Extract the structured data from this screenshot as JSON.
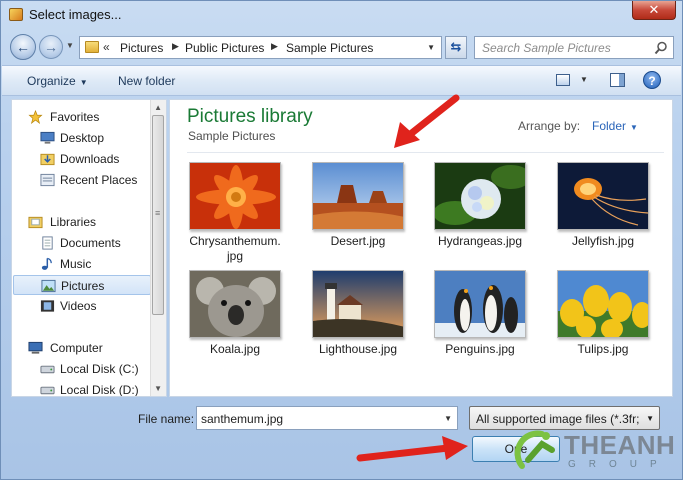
{
  "window": {
    "title": "Select images..."
  },
  "nav": {
    "address": {
      "overflow": "«",
      "crumbs": [
        "Pictures",
        "Public Pictures",
        "Sample Pictures"
      ]
    },
    "search": {
      "placeholder": "Search Sample Pictures"
    }
  },
  "toolbar": {
    "organize": "Organize",
    "new_folder": "New folder"
  },
  "sidebar": {
    "favorites": {
      "label": "Favorites",
      "items": [
        "Desktop",
        "Downloads",
        "Recent Places"
      ]
    },
    "libraries": {
      "label": "Libraries",
      "items": [
        "Documents",
        "Music",
        "Pictures",
        "Videos"
      ],
      "selected": "Pictures"
    },
    "computer": {
      "label": "Computer",
      "items": [
        "Local Disk (C:)",
        "Local Disk (D:)"
      ]
    }
  },
  "main": {
    "title": "Pictures library",
    "subtitle": "Sample Pictures",
    "arrange_label": "Arrange by:",
    "arrange_value": "Folder",
    "files": [
      {
        "name": "Chrysanthemum.\njpg",
        "display": [
          "Chrysanthemum.",
          "jpg"
        ]
      },
      {
        "name": "Desert.jpg",
        "display": [
          "Desert.jpg"
        ]
      },
      {
        "name": "Hydrangeas.jpg",
        "display": [
          "Hydrangeas.jpg"
        ]
      },
      {
        "name": "Jellyfish.jpg",
        "display": [
          "Jellyfish.jpg"
        ]
      },
      {
        "name": "Koala.jpg",
        "display": [
          "Koala.jpg"
        ]
      },
      {
        "name": "Lighthouse.jpg",
        "display": [
          "Lighthouse.jpg"
        ]
      },
      {
        "name": "Penguins.jpg",
        "display": [
          "Penguins.jpg"
        ]
      },
      {
        "name": "Tulips.jpg",
        "display": [
          "Tulips.jpg"
        ]
      }
    ]
  },
  "bottom": {
    "file_name_label": "File name:",
    "file_name_value": "santhemum.jpg",
    "file_type": "All supported image files (*.3fr;",
    "open_label": "Ope"
  },
  "watermark": {
    "brand": "THEANH",
    "sub": "GROUP"
  },
  "colors": {
    "library_title": "#1a7a35",
    "accent_link": "#2a65b9",
    "arrow": "#e0231c"
  }
}
